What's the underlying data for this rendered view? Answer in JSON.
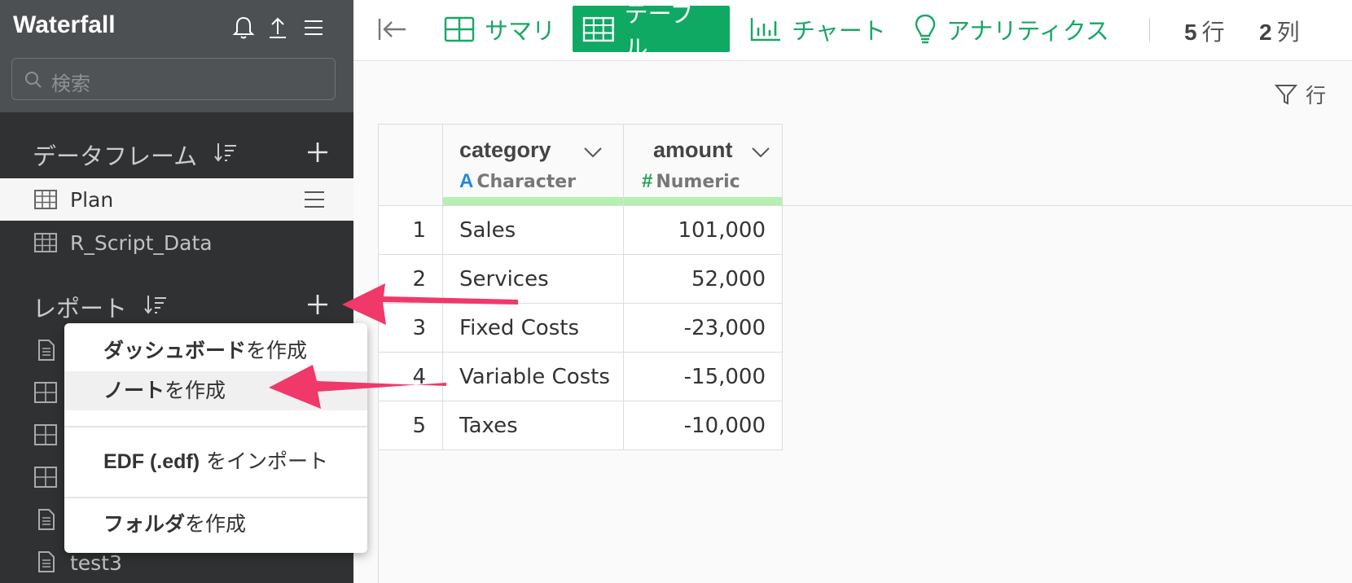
{
  "app": {
    "title": "Waterfall"
  },
  "search": {
    "placeholder": "検索"
  },
  "sidebar": {
    "dataframes_heading": "データフレーム",
    "dataframes": [
      {
        "label": "Plan",
        "selected": true
      },
      {
        "label": "R_Script_Data",
        "selected": false
      }
    ],
    "reports_heading": "レポート",
    "reports": [
      {
        "icon": "document-icon",
        "label": ""
      },
      {
        "icon": "dashboard-icon",
        "label": ""
      },
      {
        "icon": "dashboard-icon",
        "label": ""
      },
      {
        "icon": "dashboard-icon",
        "label": ""
      },
      {
        "icon": "document-icon",
        "label": ""
      },
      {
        "icon": "document-icon",
        "label": "test3"
      }
    ]
  },
  "toolbar": {
    "tabs": [
      {
        "label": "サマリ",
        "icon": "summary-icon",
        "active": false
      },
      {
        "label": "テーブル",
        "icon": "table-icon",
        "active": true
      },
      {
        "label": "チャート",
        "icon": "chart-icon",
        "active": false
      },
      {
        "label": "アナリティクス",
        "icon": "lightbulb-icon",
        "active": false
      }
    ],
    "rows_value": "5",
    "rows_unit": "行",
    "cols_value": "2",
    "cols_unit": "列"
  },
  "filter": {
    "label": "行"
  },
  "table": {
    "columns": [
      {
        "name": "category",
        "type_glyph": "A",
        "type_label": "Character",
        "glyph_color": "#1e88e5"
      },
      {
        "name": "amount",
        "type_glyph": "#",
        "type_label": "Numeric",
        "glyph_color": "#21a44f"
      }
    ],
    "rows": [
      {
        "index": "1",
        "category": "Sales",
        "amount": "101,000"
      },
      {
        "index": "2",
        "category": "Services",
        "amount": "52,000"
      },
      {
        "index": "3",
        "category": "Fixed Costs",
        "amount": "-23,000"
      },
      {
        "index": "4",
        "category": "Variable Costs",
        "amount": "-15,000"
      },
      {
        "index": "5",
        "category": "Taxes",
        "amount": "-10,000"
      }
    ]
  },
  "context_menu": {
    "items": [
      {
        "bold": "ダッシュボード",
        "rest": "を作成"
      },
      {
        "bold": "ノート",
        "rest": "を作成",
        "hover": true
      },
      {
        "bold": "EDF (.edf)",
        "rest": " をインポート"
      },
      {
        "bold": "フォルダ",
        "rest": "を作成"
      }
    ]
  },
  "colors": {
    "accent_green": "#10a964",
    "sidebar_bg": "#2f3133",
    "arrow_pink": "#f0386b"
  }
}
